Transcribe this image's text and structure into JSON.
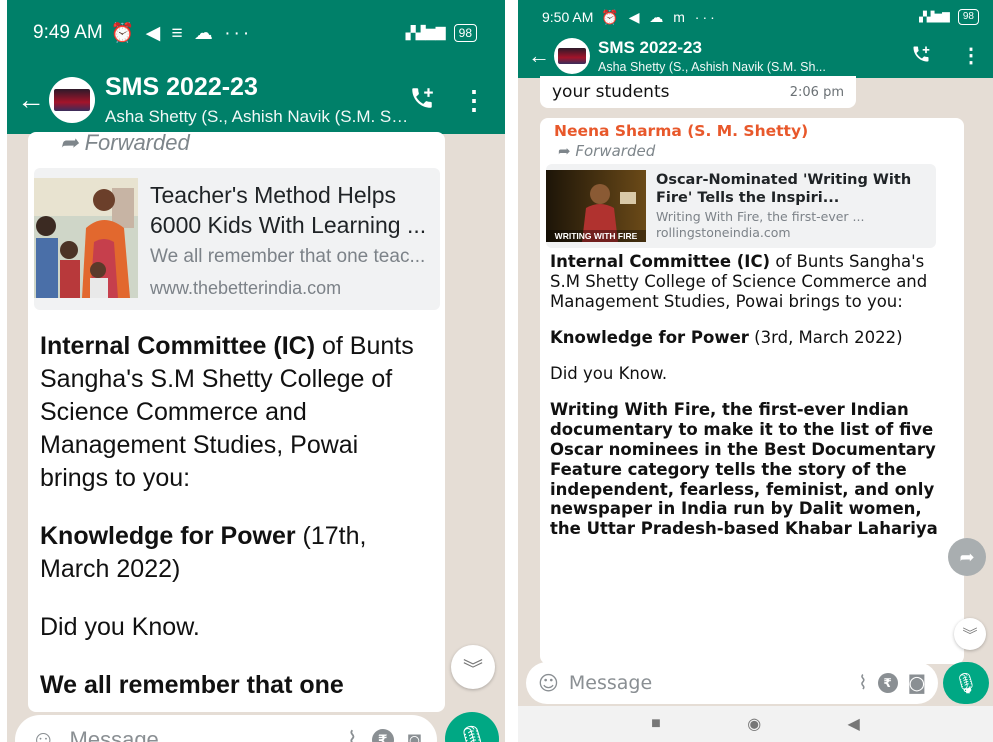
{
  "left": {
    "status": {
      "time": "9:49 AM",
      "icons": "⏰ ◀ ≡ ☁ ···",
      "network": "Vo LTE 4G",
      "battery": "98"
    },
    "header": {
      "group_name": "SMS 2022-23",
      "members": "Asha Shetty (S., Ashish Navik (S.M. Sh..."
    },
    "message": {
      "forwarded": "Forwarded",
      "link": {
        "title": "Teacher's Method Helps 6000 Kids With Learning ...",
        "description": "We all remember that one teac...",
        "url": "www.thebetterindia.com"
      },
      "para1_bold": "Internal Committee (IC)",
      "para1_rest": " of Bunts Sangha's S.M Shetty College of Science Commerce and Management Studies, Powai brings to you:",
      "para2_bold": "Knowledge for Power",
      "para2_rest": " (17th, March 2022)",
      "para3": "Did you Know.",
      "para4_bold": "We all remember that one"
    },
    "composer": {
      "placeholder": "Message"
    }
  },
  "right": {
    "status": {
      "time": "9:50 AM",
      "icons": "⏰ ◀ ☁ m ···",
      "network": "Vo LTE 4G",
      "battery": "98"
    },
    "header": {
      "group_name": "SMS 2022-23",
      "members": "Asha Shetty (S., Ashish Navik (S.M. Sh..."
    },
    "previous": {
      "text": "your students",
      "time": "2:06 pm"
    },
    "message": {
      "sender": "Neena Sharma (S. M. Shetty)",
      "forwarded": "Forwarded",
      "link": {
        "title": "Oscar-Nominated 'Writing With Fire' Tells the Inspiri...",
        "description": "Writing With Fire, the first-ever ...",
        "url": "rollingstoneindia.com",
        "thumb_caption": "WRITING WITH FIRE"
      },
      "para1_bold": "Internal Committee (IC)",
      "para1_rest": " of Bunts Sangha's S.M Shetty College of Science Commerce and Management Studies, Powai brings to you:",
      "para2_bold": "Knowledge for Power",
      "para2_rest": " (3rd, March 2022)",
      "para3": "Did you Know.",
      "para4_bold": "Writing With Fire, the first-ever Indian documentary to make it to the list of five Oscar nominees in the Best Documentary Feature category tells the story of the independent, fearless, feminist, and only newspaper in India run by Dalit women, the Uttar Pradesh-based Khabar Lahariya"
    },
    "composer": {
      "placeholder": "Message"
    }
  },
  "colors": {
    "header": "#008069",
    "chat_bg": "#e5ddd5",
    "accent": "#00a884",
    "sender": "#e8582b"
  }
}
